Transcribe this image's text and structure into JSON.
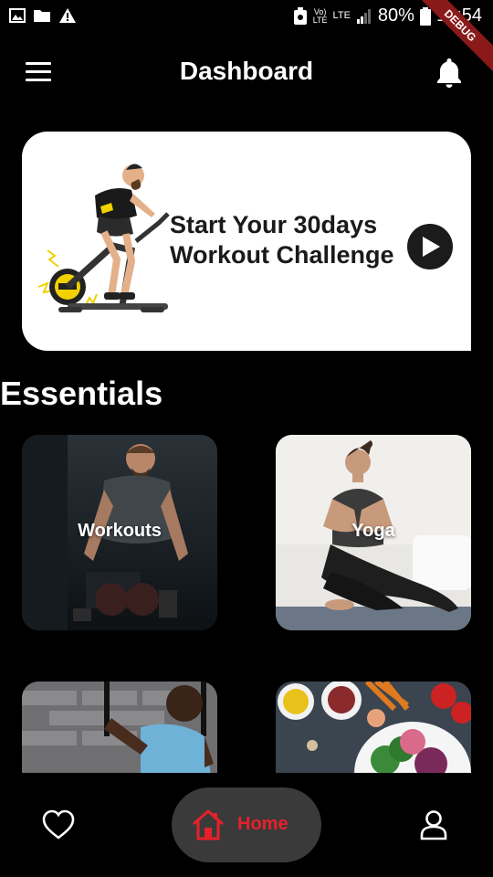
{
  "status_bar": {
    "network_top": "Vo)",
    "network_bottom": "LTE",
    "lte": "LTE",
    "battery": "80%",
    "time": "15:54",
    "debug_label": "DEBUG"
  },
  "app_bar": {
    "title": "Dashboard",
    "menu_icon": "hamburger-menu-icon",
    "notification_icon": "bell-icon"
  },
  "banner": {
    "line1": "Start Your 30days",
    "line2": "Workout Challenge",
    "action_icon": "play-icon"
  },
  "essentials": {
    "title": "Essentials",
    "cards": [
      {
        "label": "Workouts"
      },
      {
        "label": "Yoga"
      },
      {
        "label": ""
      },
      {
        "label": ""
      }
    ]
  },
  "bottom_nav": {
    "favorites_icon": "heart-icon",
    "home_label": "Home",
    "home_icon": "home-icon",
    "profile_icon": "profile-icon",
    "accent": "#e8202a"
  }
}
